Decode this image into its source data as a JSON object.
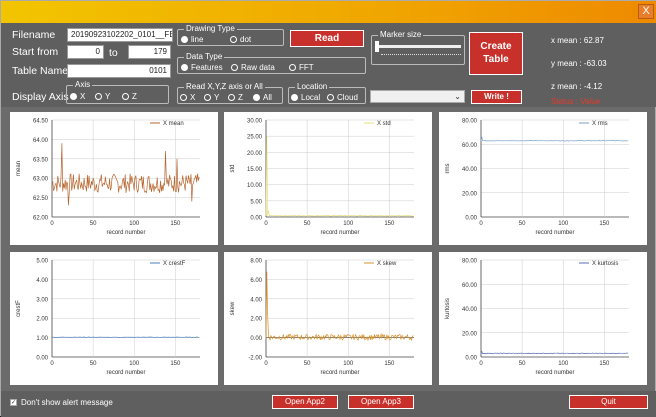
{
  "window": {
    "close_label": "X"
  },
  "form": {
    "filename_label": "Filename",
    "filename_value": "20190923102202_0101__FEA.",
    "start_label": "Start from",
    "start_value": "0",
    "to_label": "to",
    "end_value": "179",
    "table_label": "Table Name",
    "table_value": "0101",
    "display_axis_label": "Display Axis"
  },
  "axis_group": {
    "title": "Axis",
    "options": [
      "X",
      "Y",
      "Z"
    ],
    "selected": "X"
  },
  "drawing_type": {
    "title": "Drawing Type",
    "options": [
      "line",
      "dot"
    ],
    "selected": "line"
  },
  "data_type": {
    "title": "Data Type",
    "options": [
      "Features",
      "Raw data",
      "FFT"
    ],
    "selected": "Features"
  },
  "read_axis": {
    "title": "Read X,Y,Z axis or All",
    "options": [
      "X",
      "Y",
      "Z",
      "All"
    ],
    "selected": "All"
  },
  "location": {
    "title": "Location",
    "options": [
      "Local",
      "Cloud"
    ],
    "selected": "Local"
  },
  "buttons": {
    "read": "Read",
    "create_line1": "Create",
    "create_line2": "Table",
    "write": "Write !"
  },
  "marker_size": {
    "label": "Marker size",
    "value_fraction": 0.0
  },
  "stats": {
    "x_mean": "x mean : 62.87",
    "y_mean": "y mean : -63.03",
    "z_mean": "z mean : -4.12",
    "status": "Status : Value"
  },
  "footer": {
    "dont_show": "Don't show alert message",
    "dont_show_checked": true,
    "open_app2": "Open App2",
    "open_app3": "Open App3",
    "quit": "Quit"
  },
  "colors": {
    "accent_red": "#c8302b",
    "status_red": "#e53a2b",
    "title_yellow": "#f2c500"
  },
  "chart_data": [
    {
      "type": "line",
      "legend": "X mean",
      "ylabel": "mean",
      "xlabel": "record number",
      "ylim": [
        62.0,
        64.5
      ],
      "yticks": [
        "62.00",
        "62.50",
        "63.00",
        "63.50",
        "64.00",
        "64.50"
      ],
      "xticks": [
        "0",
        "50",
        "100",
        "150"
      ],
      "xlim": [
        0,
        180
      ],
      "color": "#b7652e",
      "shape": "noisy",
      "base": 62.87,
      "amp": 0.25,
      "spikes": [
        [
          12,
          63.9
        ],
        [
          20,
          62.3
        ],
        [
          138,
          63.7
        ],
        [
          152,
          63.5
        ],
        [
          170,
          62.4
        ]
      ]
    },
    {
      "type": "line",
      "legend": "X std",
      "ylabel": "std",
      "xlabel": "record number",
      "ylim": [
        0,
        30
      ],
      "yticks": [
        "0.00",
        "5.00",
        "10.00",
        "15.00",
        "20.00",
        "25.00",
        "30.00"
      ],
      "xticks": [
        "0",
        "50",
        "100",
        "150"
      ],
      "xlim": [
        0,
        180
      ],
      "color": "#e8e07a",
      "shape": "spike-start",
      "base": 0.4,
      "amp": 0.15,
      "spikes": [
        [
          1,
          25
        ],
        [
          3,
          2
        ]
      ]
    },
    {
      "type": "line",
      "legend": "X rms",
      "ylabel": "rms",
      "xlabel": "record number",
      "ylim": [
        0,
        80
      ],
      "yticks": [
        "0.00",
        "20.00",
        "40.00",
        "60.00",
        "80.00"
      ],
      "xticks": [
        "0",
        "50",
        "100",
        "150"
      ],
      "xlim": [
        0,
        180
      ],
      "color": "#7aa0c8",
      "shape": "flat",
      "base": 62.9,
      "amp": 0.2,
      "spikes": [
        [
          1,
          66
        ]
      ]
    },
    {
      "type": "line",
      "legend": "X crestF",
      "ylabel": "crestF",
      "xlabel": "record number",
      "ylim": [
        0,
        5
      ],
      "yticks": [
        "0.00",
        "1.00",
        "2.00",
        "3.00",
        "4.00",
        "5.00"
      ],
      "xticks": [
        "0",
        "50",
        "100",
        "150"
      ],
      "xlim": [
        0,
        180
      ],
      "color": "#4a7fc1",
      "shape": "flat",
      "base": 1.02,
      "amp": 0.01,
      "spikes": []
    },
    {
      "type": "line",
      "legend": "X skew",
      "ylabel": "skew",
      "xlabel": "record number",
      "ylim": [
        -2,
        8
      ],
      "yticks": [
        "-2.00",
        "0.00",
        "2.00",
        "4.00",
        "6.00",
        "8.00"
      ],
      "xticks": [
        "0",
        "50",
        "100",
        "150"
      ],
      "xlim": [
        0,
        180
      ],
      "color": "#d9902a",
      "shape": "noisy",
      "base": 0.05,
      "amp": 0.3,
      "spikes": [
        [
          1,
          6.8
        ],
        [
          2,
          2.5
        ]
      ]
    },
    {
      "type": "line",
      "legend": "X kurtosis",
      "ylabel": "kurtosis",
      "xlabel": "record number",
      "ylim": [
        0,
        80
      ],
      "yticks": [
        "0.00",
        "20.00",
        "40.00",
        "60.00",
        "80.00"
      ],
      "xticks": [
        "0",
        "50",
        "100",
        "150"
      ],
      "xlim": [
        0,
        180
      ],
      "color": "#5a6fb0",
      "shape": "flat",
      "base": 3.0,
      "amp": 0.3,
      "spikes": [
        [
          1,
          4.5
        ]
      ]
    }
  ]
}
